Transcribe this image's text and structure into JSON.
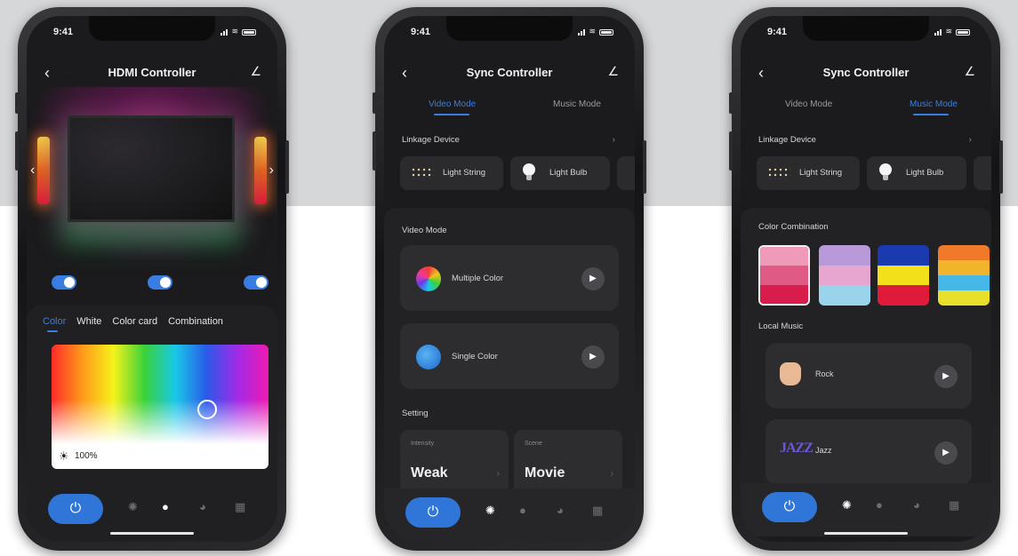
{
  "status": {
    "time": "9:41"
  },
  "phone1": {
    "title": "HDMI Controller",
    "tabs": [
      "Color",
      "White",
      "Color card",
      "Combination"
    ],
    "brightness": "100%",
    "toggles": [
      true,
      true,
      true
    ]
  },
  "phone2": {
    "title": "Sync Controller",
    "mode_tabs": [
      "Video Mode",
      "Music Mode"
    ],
    "active_mode": "Video Mode",
    "linkage_label": "Linkage Device",
    "devices": [
      "Light String",
      "Light Bulb"
    ],
    "video_mode_label": "Video Mode",
    "modes": [
      "Multiple Color",
      "Single Color"
    ],
    "setting_label": "Setting",
    "settings": [
      {
        "caption": "Intensity",
        "value": "Weak"
      },
      {
        "caption": "Scene",
        "value": "Movie"
      }
    ]
  },
  "phone3": {
    "title": "Sync Controller",
    "mode_tabs": [
      "Video Mode",
      "Music Mode"
    ],
    "active_mode": "Music Mode",
    "linkage_label": "Linkage Device",
    "devices": [
      "Light String",
      "Light Bulb"
    ],
    "color_combination_label": "Color Combination",
    "swatches": [
      [
        "#ef9ab8",
        "#e05a86",
        "#d81c4c"
      ],
      [
        "#b89ad8",
        "#e6a6d0",
        "#9ad4ec"
      ],
      [
        "#1a3ab0",
        "#f2e01a",
        "#e01a3a"
      ],
      [
        "#f07a2a",
        "#f2b42a",
        "#46b8e8",
        "#e8e02a"
      ]
    ],
    "local_music_label": "Local Music",
    "music": [
      "Rock",
      "Jazz"
    ],
    "jazz_logo": "JAZZ"
  },
  "icons": {
    "power": "⏻",
    "back": "‹",
    "edit": "⁄",
    "play": "▶"
  }
}
